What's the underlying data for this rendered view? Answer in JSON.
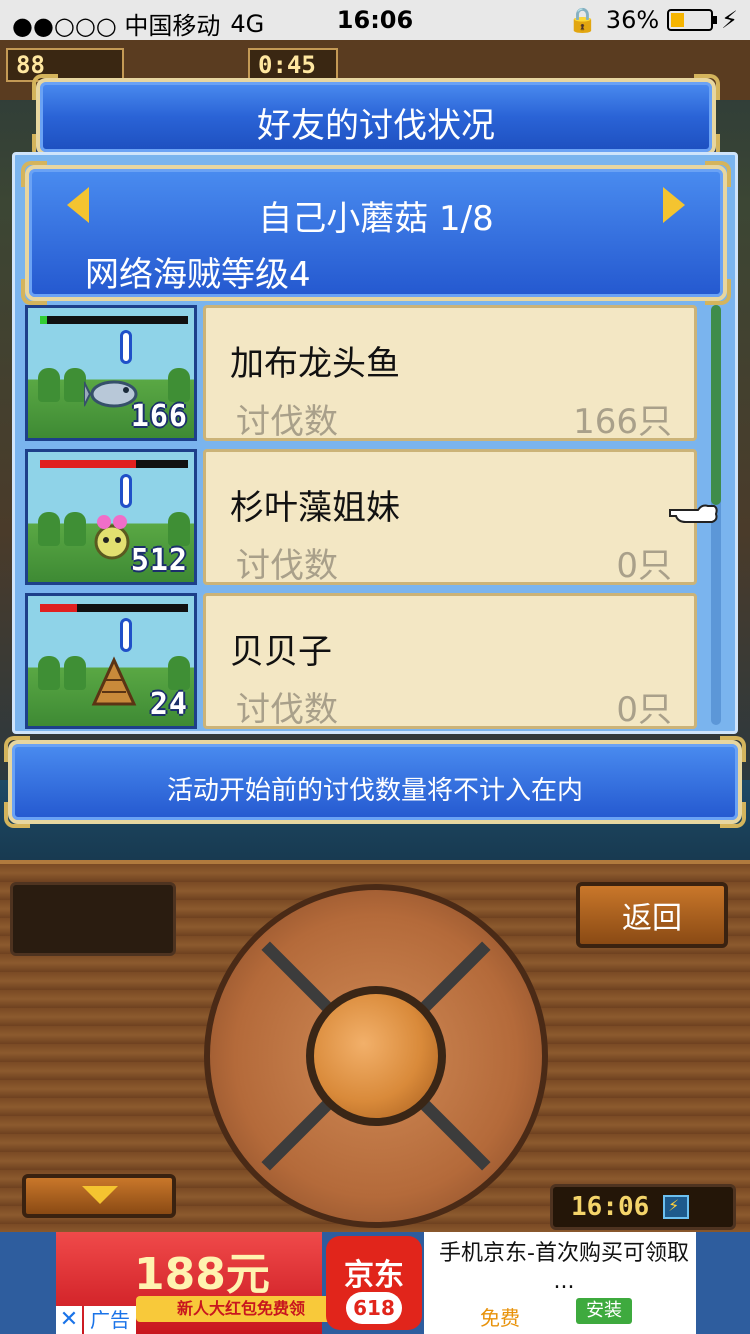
{
  "status_bar": {
    "carrier": "●●○○○ 中国移动",
    "network": "4G",
    "time": "16:06",
    "battery": "36%",
    "battery_level": 0.36
  },
  "hud": {
    "level": "88",
    "timer": "0:45"
  },
  "dialog": {
    "title": "好友的讨伐状况",
    "friend_name": "自己小蘑菇 1/8",
    "pirate_level": "网络海贼等级4",
    "notice": "活动开始前的讨伐数量将不计入在内"
  },
  "monsters": [
    {
      "name": "加布龙头鱼",
      "label": "讨伐数",
      "value": "166只",
      "count_badge": "166",
      "hp": 0.05,
      "hp_color": "#33cc33"
    },
    {
      "name": "杉叶藻姐妹",
      "label": "讨伐数",
      "value": "0只",
      "count_badge": "512",
      "hp": 0.65,
      "hp_color": "#e02020"
    },
    {
      "name": "贝贝子",
      "label": "讨伐数",
      "value": "0只",
      "count_badge": "24",
      "hp": 0.25,
      "hp_color": "#e02020"
    }
  ],
  "controls": {
    "back_label": "返回",
    "clock": "16:06"
  },
  "ad": {
    "amount": "188元",
    "promo": "新人大红包免费领",
    "close_glyph": "✕",
    "tag": "广告",
    "jd_logo": "京东",
    "jd_sub": "618",
    "title": "手机京东-首次购买可领取 ...",
    "free": "免费",
    "install": "安装"
  }
}
